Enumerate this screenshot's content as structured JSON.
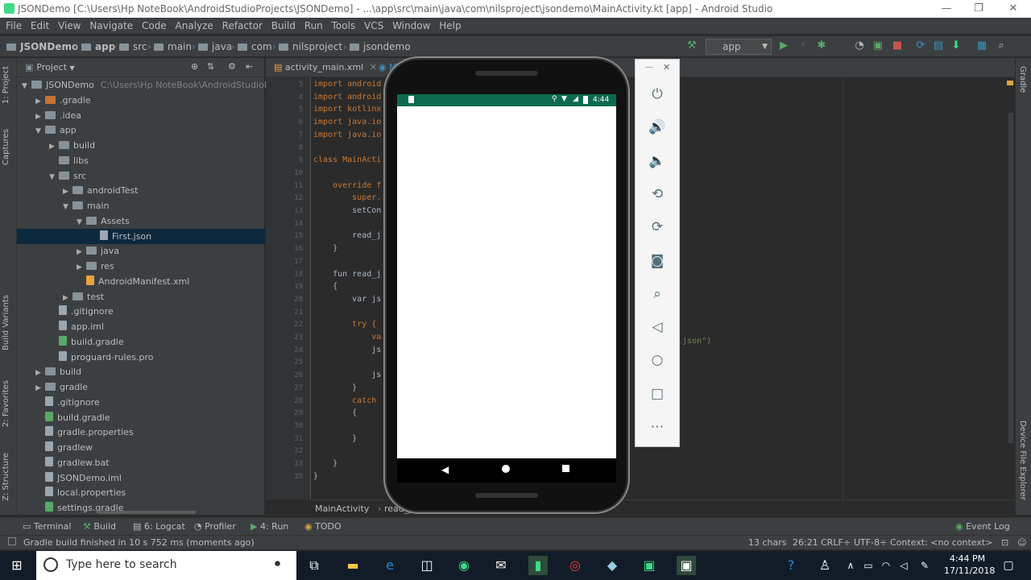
{
  "window": {
    "title": "JSONDemo [C:\\Users\\Hp NoteBook\\AndroidStudioProjects\\JSONDemo] - ...\\app\\src\\main\\java\\com\\nilsproject\\jsondemo\\MainActivity.kt [app] - Android Studio",
    "minimize": "—",
    "maximize": "❐",
    "close": "✕"
  },
  "menu": [
    "File",
    "Edit",
    "View",
    "Navigate",
    "Code",
    "Analyze",
    "Refactor",
    "Build",
    "Run",
    "Tools",
    "VCS",
    "Window",
    "Help"
  ],
  "nav": {
    "crumbs": [
      "JSONDemo",
      "app",
      "src",
      "main",
      "java",
      "com",
      "nilsproject",
      "jsondemo"
    ],
    "run_config": "app"
  },
  "left_strip": {
    "project": "1: Project",
    "captures": "Captures",
    "build_variants": "Build Variants",
    "favorites": "2: Favorites",
    "structure": "Z: Structure"
  },
  "right_strip": {
    "gradle": "Gradle",
    "device_file_explorer": "Device File Explorer"
  },
  "project_panel": {
    "title": "Project",
    "tree": [
      {
        "label": "JSONDemo",
        "extra": "C:\\Users\\Hp NoteBook\\AndroidStudioPr",
        "depth": 0,
        "open": true,
        "icon": "folder"
      },
      {
        "label": ".gradle",
        "depth": 1,
        "open": false,
        "icon": "folder-orange"
      },
      {
        "label": ".idea",
        "depth": 1,
        "open": false,
        "icon": "folder"
      },
      {
        "label": "app",
        "depth": 1,
        "open": true,
        "icon": "folder"
      },
      {
        "label": "build",
        "depth": 2,
        "open": false,
        "icon": "folder"
      },
      {
        "label": "libs",
        "depth": 2,
        "open": null,
        "icon": "folder"
      },
      {
        "label": "src",
        "depth": 2,
        "open": true,
        "icon": "folder"
      },
      {
        "label": "androidTest",
        "depth": 3,
        "open": false,
        "icon": "folder"
      },
      {
        "label": "main",
        "depth": 3,
        "open": true,
        "icon": "folder"
      },
      {
        "label": "Assets",
        "depth": 4,
        "open": true,
        "icon": "folder"
      },
      {
        "label": "First.json",
        "depth": 5,
        "open": null,
        "icon": "file",
        "selected": true
      },
      {
        "label": "java",
        "depth": 4,
        "open": false,
        "icon": "folder"
      },
      {
        "label": "res",
        "depth": 4,
        "open": false,
        "icon": "folder"
      },
      {
        "label": "AndroidManifest.xml",
        "depth": 4,
        "open": null,
        "icon": "xml"
      },
      {
        "label": "test",
        "depth": 3,
        "open": false,
        "icon": "folder"
      },
      {
        "label": ".gitignore",
        "depth": 2,
        "open": null,
        "icon": "file"
      },
      {
        "label": "app.iml",
        "depth": 2,
        "open": null,
        "icon": "file"
      },
      {
        "label": "build.gradle",
        "depth": 2,
        "open": null,
        "icon": "gradle"
      },
      {
        "label": "proguard-rules.pro",
        "depth": 2,
        "open": null,
        "icon": "file"
      },
      {
        "label": "build",
        "depth": 1,
        "open": false,
        "icon": "folder"
      },
      {
        "label": "gradle",
        "depth": 1,
        "open": false,
        "icon": "folder"
      },
      {
        "label": ".gitignore",
        "depth": 1,
        "open": null,
        "icon": "file"
      },
      {
        "label": "build.gradle",
        "depth": 1,
        "open": null,
        "icon": "gradle"
      },
      {
        "label": "gradle.properties",
        "depth": 1,
        "open": null,
        "icon": "file"
      },
      {
        "label": "gradlew",
        "depth": 1,
        "open": null,
        "icon": "file"
      },
      {
        "label": "gradlew.bat",
        "depth": 1,
        "open": null,
        "icon": "file"
      },
      {
        "label": "JSONDemo.iml",
        "depth": 1,
        "open": null,
        "icon": "file"
      },
      {
        "label": "local.properties",
        "depth": 1,
        "open": null,
        "icon": "file"
      },
      {
        "label": "settings.gradle",
        "depth": 1,
        "open": null,
        "icon": "gradle"
      }
    ]
  },
  "editor": {
    "tabs": [
      "activity_main.xml",
      "M"
    ],
    "lines": [
      {
        "n": "3",
        "code": "import android"
      },
      {
        "n": "4",
        "code": "import android"
      },
      {
        "n": "5",
        "code": "import kotlinx"
      },
      {
        "n": "6",
        "code": "import java.io"
      },
      {
        "n": "7",
        "code": "import java.io"
      },
      {
        "n": "8",
        "code": ""
      },
      {
        "n": "9",
        "code": "class MainActi"
      },
      {
        "n": "10",
        "code": ""
      },
      {
        "n": "11",
        "code": "    override f"
      },
      {
        "n": "12",
        "code": "        super."
      },
      {
        "n": "13",
        "code": "        setCon"
      },
      {
        "n": "14",
        "code": ""
      },
      {
        "n": "15",
        "code": "        read_j"
      },
      {
        "n": "16",
        "code": "    }"
      },
      {
        "n": "17",
        "code": ""
      },
      {
        "n": "18",
        "code": "    fun read_j"
      },
      {
        "n": "19",
        "code": "    {"
      },
      {
        "n": "20",
        "code": "        var js"
      },
      {
        "n": "21",
        "code": ""
      },
      {
        "n": "22",
        "code": "        try {"
      },
      {
        "n": "23",
        "code": "            va"
      },
      {
        "n": "24",
        "code": "            js"
      },
      {
        "n": "25",
        "code": ""
      },
      {
        "n": "26",
        "code": "            js"
      },
      {
        "n": "27",
        "code": "        }"
      },
      {
        "n": "28",
        "code": "        catch"
      },
      {
        "n": "29",
        "code": "        {"
      },
      {
        "n": "30",
        "code": ""
      },
      {
        "n": "31",
        "code": "        }"
      },
      {
        "n": "32",
        "code": ""
      },
      {
        "n": "33",
        "code": "    }"
      },
      {
        "n": "35",
        "code": "}"
      }
    ],
    "right_fragment": "t.json\")",
    "breadcrumb": [
      "MainActivity",
      "read_j"
    ]
  },
  "phone": {
    "time": "4:44"
  },
  "emulator_controls": [
    "power-icon",
    "volume-up-icon",
    "volume-down-icon",
    "rotate-left-icon",
    "rotate-right-icon",
    "camera-icon",
    "zoom-icon",
    "back-icon",
    "home-icon",
    "overview-icon",
    "more-icon"
  ],
  "bottom_tabs": [
    "Terminal",
    "Build",
    "6: Logcat",
    "Profiler",
    "4: Run",
    "TODO"
  ],
  "event_log": "Event Log",
  "status": {
    "message": "Gradle build finished in 10 s 752 ms (moments ago)",
    "chars": "13 chars",
    "position": "26:21",
    "line_sep": "CRLF÷",
    "encoding": "UTF-8÷",
    "context": "Context: <no context>"
  },
  "taskbar": {
    "search_placeholder": "Type here to search",
    "time": "4:44 PM",
    "date": "17/11/2018"
  }
}
